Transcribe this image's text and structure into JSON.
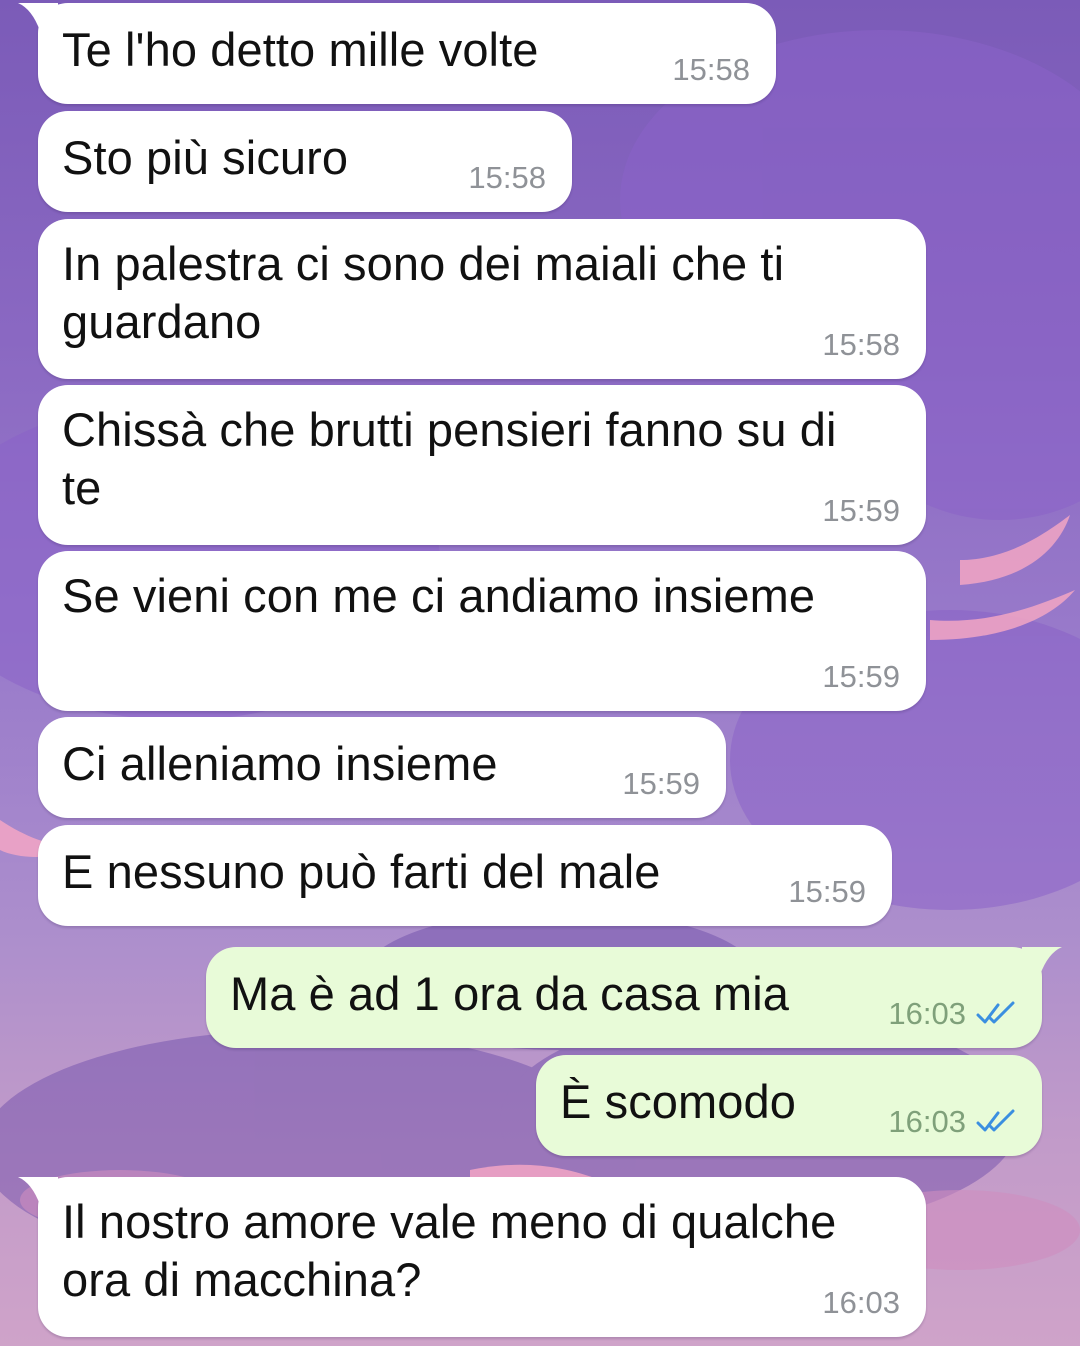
{
  "messages": [
    {
      "text": "Te l'ho detto mille volte",
      "time": "15:58",
      "dir": "in"
    },
    {
      "text": "Sto più sicuro",
      "time": "15:58",
      "dir": "in"
    },
    {
      "text": "In palestra ci sono dei maiali che ti\nguardano",
      "time": "15:58",
      "dir": "in"
    },
    {
      "text": "Chissà che brutti pensieri fanno su di\nte",
      "time": "15:59",
      "dir": "in"
    },
    {
      "text": "Se vieni con me ci andiamo insieme",
      "time": "15:59",
      "dir": "in"
    },
    {
      "text": "Ci alleniamo insieme",
      "time": "15:59",
      "dir": "in"
    },
    {
      "text": "E nessuno può farti del male",
      "time": "15:59",
      "dir": "in"
    },
    {
      "text": "Ma è ad 1 ora da casa mia",
      "time": "16:03",
      "dir": "out",
      "status_icon": "double-check-icon"
    },
    {
      "text": "È scomodo",
      "time": "16:03",
      "dir": "out",
      "status_icon": "double-check-icon"
    },
    {
      "text": "Il nostro amore vale meno di qualche\nora di macchina?",
      "time": "16:03",
      "dir": "in"
    }
  ],
  "colors": {
    "incoming_bubble": "#ffffff",
    "outgoing_bubble": "#e8fbd8",
    "read_check": "#3b8fe0",
    "time_text": "#8f9297"
  }
}
